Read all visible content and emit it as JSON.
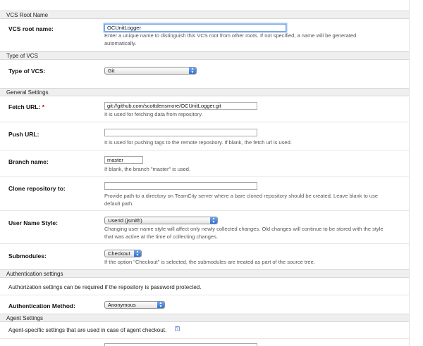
{
  "sections": {
    "vcs_root_name": "VCS Root Name",
    "type_of_vcs": "Type of VCS",
    "general": "General Settings",
    "auth": "Authentication settings",
    "agent": "Agent Settings"
  },
  "fields": {
    "vcs_root_name": {
      "label": "VCS root name:",
      "value": "OCUnitLogger",
      "note": "Enter a unique name to distinguish this VCS root from other roots. If not specified, a name will be generated automatically."
    },
    "type_of_vcs": {
      "label": "Type of VCS:",
      "value": "Git"
    },
    "fetch_url": {
      "label": "Fetch URL:",
      "required": "*",
      "value": "git://github.com/scottdensmore/OCUnitLogger.git",
      "note": "It is used for fetching data from repository."
    },
    "push_url": {
      "label": "Push URL:",
      "value": "",
      "note": "It is used for pushing tags to the remote repository. If blank, the fetch url is used."
    },
    "branch_name": {
      "label": "Branch name:",
      "value": "master",
      "note": "If blank, the branch \"master\" is used."
    },
    "clone_repo": {
      "label": "Clone repository to:",
      "value": "",
      "note": "Provide path to a directory on TeamCity server where a bare cloned repository should be created. Leave blank to use default path."
    },
    "user_name_style": {
      "label": "User Name Style:",
      "value": "UserId (jsmith)",
      "note": "Changing user name style will affect only newly collected changes. Old changes will continue to be stored with the style that was active at the time of collecting changes."
    },
    "submodules": {
      "label": "Submodules:",
      "value": "Checkout",
      "note": "If the option \"Checkout\" is selected, the submodules are treated as part of the source tree."
    },
    "auth_note": "Authorization settings can be required if the repository is password protected.",
    "auth_method": {
      "label": "Authentication Method:",
      "value": "Anonymous"
    },
    "agent_note": "Agent-specific settings that are used in case of agent checkout."
  },
  "icons": {
    "select_arrow": "up-down-arrows-icon",
    "help": "help-icon"
  },
  "colors": {
    "section_bg": "#efefef",
    "required": "#cc0000",
    "focus": "#6aa1e6",
    "select_arrow": "#2f6fd2"
  }
}
